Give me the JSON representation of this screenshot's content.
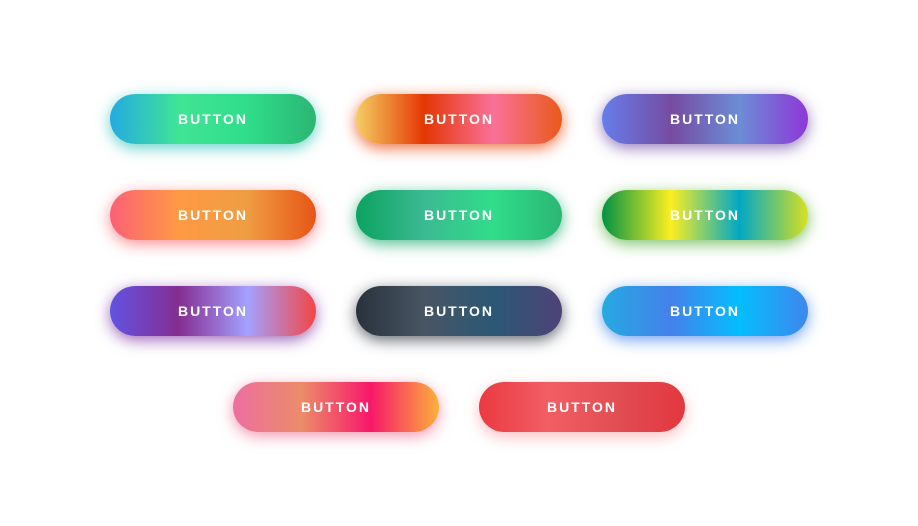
{
  "buttons": {
    "row1": [
      {
        "label": "BUTTON"
      },
      {
        "label": "BUTTON"
      },
      {
        "label": "BUTTON"
      }
    ],
    "row2": [
      {
        "label": "BUTTON"
      },
      {
        "label": "BUTTON"
      },
      {
        "label": "BUTTON"
      }
    ],
    "row3": [
      {
        "label": "BUTTON"
      },
      {
        "label": "BUTTON"
      },
      {
        "label": "BUTTON"
      }
    ],
    "row4": [
      {
        "label": "BUTTON"
      },
      {
        "label": "BUTTON"
      }
    ]
  }
}
